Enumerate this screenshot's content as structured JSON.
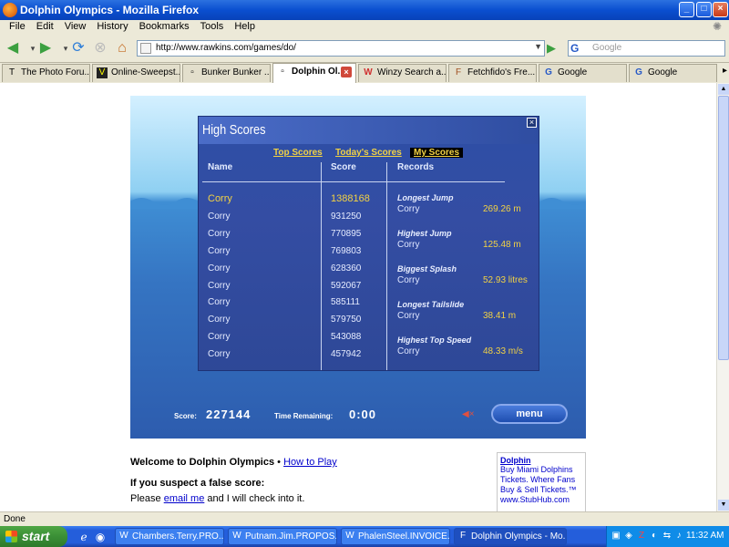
{
  "window": {
    "title": "Dolphin Olympics - Mozilla Firefox"
  },
  "menu": [
    "File",
    "Edit",
    "View",
    "History",
    "Bookmarks",
    "Tools",
    "Help"
  ],
  "nav": {
    "url": "http://www.rawkins.com/games/do/",
    "search_placeholder": "Google",
    "search_engine": "G"
  },
  "tabs": [
    {
      "label": "The Photo Foru...",
      "icon": "T"
    },
    {
      "label": "Online-Sweepst...",
      "icon": "V"
    },
    {
      "label": "Bunker Bunker ...",
      "icon": ""
    },
    {
      "label": "Dolphin Ol...",
      "icon": "",
      "active": true
    },
    {
      "label": "Winzy Search a...",
      "icon": "W"
    },
    {
      "label": "Fetchfido's Fre...",
      "icon": "F"
    },
    {
      "label": "Google",
      "icon": "G"
    },
    {
      "label": "Google",
      "icon": "G"
    }
  ],
  "game": {
    "panel_title": "High Scores",
    "tabs": [
      "Top Scores",
      "Today's Scores",
      "My Scores"
    ],
    "columns": {
      "name": "Name",
      "score": "Score",
      "records": "Records"
    },
    "scores": [
      {
        "name": "Corry",
        "score": "1388168"
      },
      {
        "name": "Corry",
        "score": "931250"
      },
      {
        "name": "Corry",
        "score": "770895"
      },
      {
        "name": "Corry",
        "score": "769803"
      },
      {
        "name": "Corry",
        "score": "628360"
      },
      {
        "name": "Corry",
        "score": "592067"
      },
      {
        "name": "Corry",
        "score": "585111"
      },
      {
        "name": "Corry",
        "score": "579750"
      },
      {
        "name": "Corry",
        "score": "543088"
      },
      {
        "name": "Corry",
        "score": "457942"
      }
    ],
    "records": [
      {
        "title": "Longest Jump",
        "name": "Corry",
        "value": "269.26 m"
      },
      {
        "title": "Highest Jump",
        "name": "Corry",
        "value": "125.48 m"
      },
      {
        "title": "Biggest Splash",
        "name": "Corry",
        "value": "52.93 litres"
      },
      {
        "title": "Longest Tailslide",
        "name": "Corry",
        "value": "38.41 m"
      },
      {
        "title": "Highest Top Speed",
        "name": "Corry",
        "value": "48.33 m/s"
      }
    ],
    "score_label": "Score:",
    "score_value": "227144",
    "time_label": "Time Remaining:",
    "time_value": "0:00",
    "menu_label": "menu"
  },
  "page_text": {
    "welcome": "Welcome to Dolphin Olympics",
    "bullet": " • ",
    "how_to_play": "How to Play",
    "suspect": "If you suspect a false score:",
    "please_prefix": "Please ",
    "email_link": "email me",
    "please_suffix": " and I will check into it."
  },
  "ad": {
    "title": "Dolphin",
    "text": "Buy Miami Dolphins Tickets. Where Fans Buy & Sell Tickets.™ www.StubHub.com"
  },
  "status": "Done",
  "taskbar": {
    "start": "start",
    "tasks": [
      {
        "label": "Chambers.Terry.PRO...",
        "icon": "W"
      },
      {
        "label": "Putnam.Jim.PROPOS...",
        "icon": "W"
      },
      {
        "label": "PhalenSteel.INVOICE...",
        "icon": "W"
      },
      {
        "label": "Dolphin Olympics - Mo...",
        "icon": "F",
        "active": true
      }
    ],
    "clock": "11:32 AM"
  }
}
